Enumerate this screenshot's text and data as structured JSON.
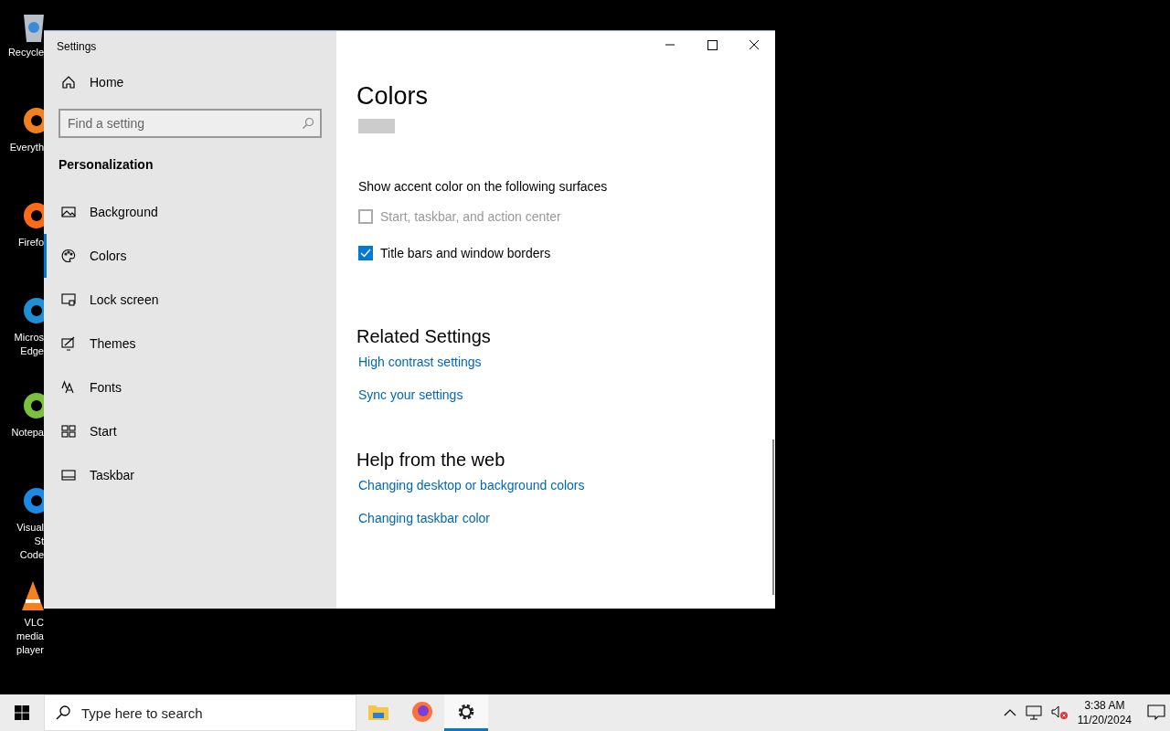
{
  "desktop_icons": [
    {
      "label": "Recycle"
    },
    {
      "label": "Everyth"
    },
    {
      "label": "Firefo"
    },
    {
      "label": "Micros Edge"
    },
    {
      "label": "Notepa"
    },
    {
      "label": "Visual St Code"
    },
    {
      "label": "VLC media player"
    }
  ],
  "window": {
    "title": "Settings"
  },
  "sidebar": {
    "home": "Home",
    "search": {
      "placeholder": "Find a setting"
    },
    "section": "Personalization",
    "items": [
      {
        "label": "Background",
        "selected": false
      },
      {
        "label": "Colors",
        "selected": true
      },
      {
        "label": "Lock screen",
        "selected": false
      },
      {
        "label": "Themes",
        "selected": false
      },
      {
        "label": "Fonts",
        "selected": false
      },
      {
        "label": "Start",
        "selected": false
      },
      {
        "label": "Taskbar",
        "selected": false
      }
    ]
  },
  "content": {
    "title": "Colors",
    "surfaces_heading": "Show accent color on the following surfaces",
    "checkboxes": [
      {
        "label": "Start, taskbar, and action center",
        "checked": false,
        "disabled": true
      },
      {
        "label": "Title bars and window borders",
        "checked": true,
        "disabled": false
      }
    ],
    "sections": [
      {
        "heading": "Related Settings",
        "links": [
          "High contrast settings",
          "Sync your settings"
        ]
      },
      {
        "heading": "Help from the web",
        "links": [
          "Changing desktop or background colors",
          "Changing taskbar color"
        ]
      }
    ]
  },
  "taskbar": {
    "search_placeholder": "Type here to search",
    "apps": [
      {
        "selected": false
      },
      {
        "selected": false
      },
      {
        "selected": true
      }
    ],
    "time": "3:38 AM",
    "date": "11/20/2024"
  }
}
